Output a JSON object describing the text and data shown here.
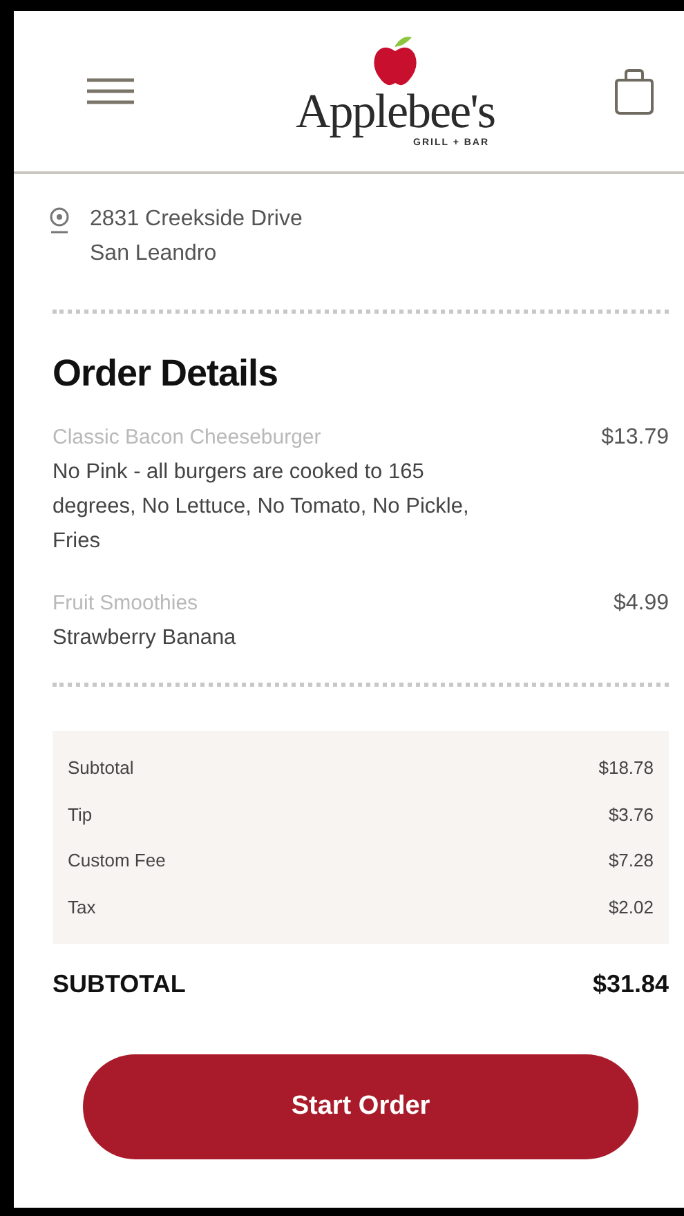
{
  "header": {
    "logo": {
      "name": "Applebee's",
      "tagline": "GRILL + BAR"
    }
  },
  "location": {
    "address_line_1": "2831 Creekside Drive",
    "address_line_2": "San Leandro"
  },
  "order_details": {
    "title": "Order Details",
    "items": [
      {
        "name": "Classic Bacon Cheeseburger",
        "description": "No Pink - all burgers are cooked to 165 degrees, No Lettuce, No Tomato, No Pickle, Fries",
        "price": "$13.79"
      },
      {
        "name": "Fruit Smoothies",
        "description": "Strawberry Banana",
        "price": "$4.99"
      }
    ]
  },
  "summary": {
    "rows": [
      {
        "label": "Subtotal",
        "value": "$18.78"
      },
      {
        "label": "Tip",
        "value": "$3.76"
      },
      {
        "label": "Custom Fee",
        "value": "$7.28"
      },
      {
        "label": "Tax",
        "value": "$2.02"
      }
    ],
    "total": {
      "label": "SUBTOTAL",
      "value": "$31.84"
    }
  },
  "buttons": [
    {
      "label": "Start Order"
    }
  ]
}
